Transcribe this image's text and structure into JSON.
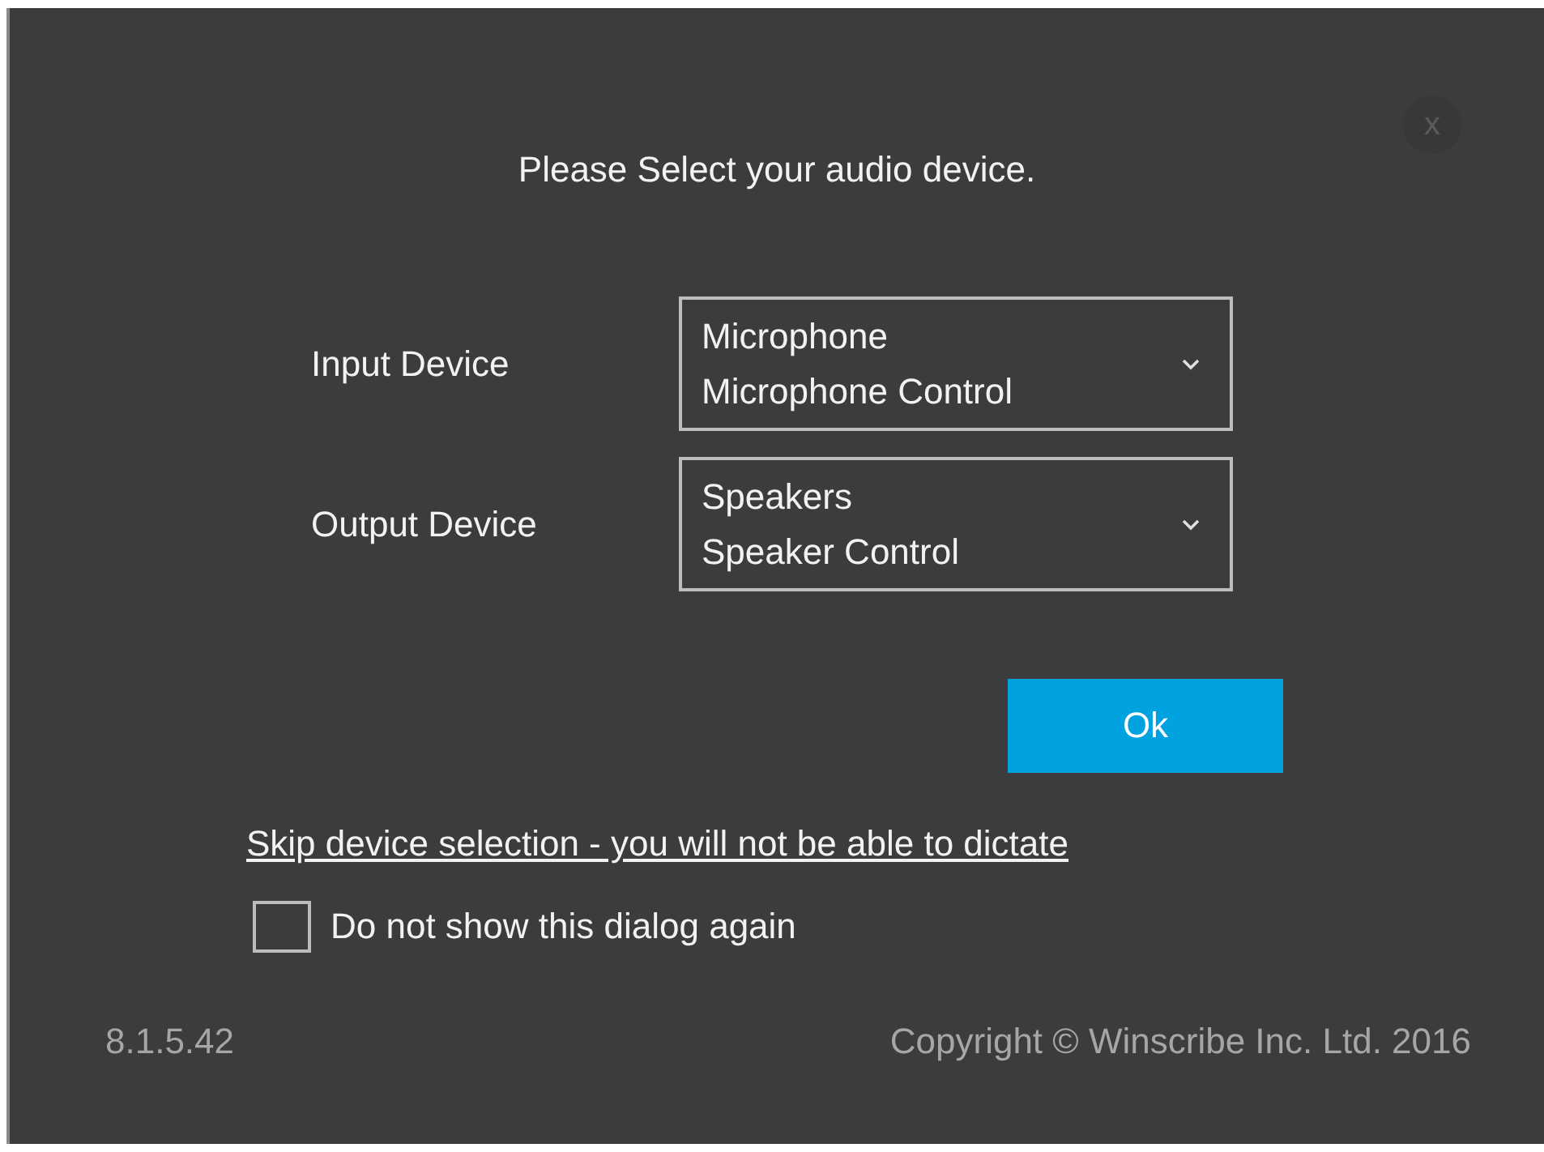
{
  "dialog": {
    "close_label": "x",
    "title": "Please Select your audio device.",
    "devices": [
      {
        "label": "Input Device",
        "value_lines": [
          "Microphone",
          "Microphone Control"
        ]
      },
      {
        "label": "Output Device",
        "value_lines": [
          "Speakers",
          "Speaker Control"
        ]
      }
    ],
    "ok_button": "Ok",
    "skip_link": "Skip device selection - you will not be able to dictate",
    "dont_show_again": {
      "label": "Do not show this dialog again",
      "checked": false
    },
    "version": "8.1.5.42",
    "copyright": "Copyright © Winscribe Inc. Ltd. 2016"
  }
}
